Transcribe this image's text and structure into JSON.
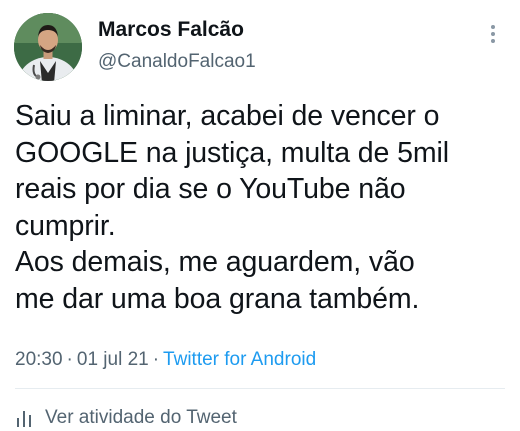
{
  "tweet": {
    "author": {
      "display_name": "Marcos Falcão",
      "handle": "@CanaldoFalcao1",
      "avatar_icon": "profile-photo"
    },
    "more_icon": "vertical-ellipsis-icon",
    "text_lines": [
      "Saiu a liminar, acabei de vencer o",
      "GOOGLE na justiça, multa de 5mil",
      "reais por dia se o YouTube não",
      "cumprir.",
      "Aos demais,  me aguardem, vão",
      "me dar uma boa grana também."
    ],
    "time": "20:30",
    "separator": "·",
    "date": "01 jul 21",
    "source": "Twitter for Android",
    "activity_icon": "bar-chart-icon",
    "activity_label": "Ver atividade do Tweet",
    "colors": {
      "text": "#0f1419",
      "secondary": "#536471",
      "link": "#1d9bf0",
      "divider": "#e6ecf0"
    }
  }
}
